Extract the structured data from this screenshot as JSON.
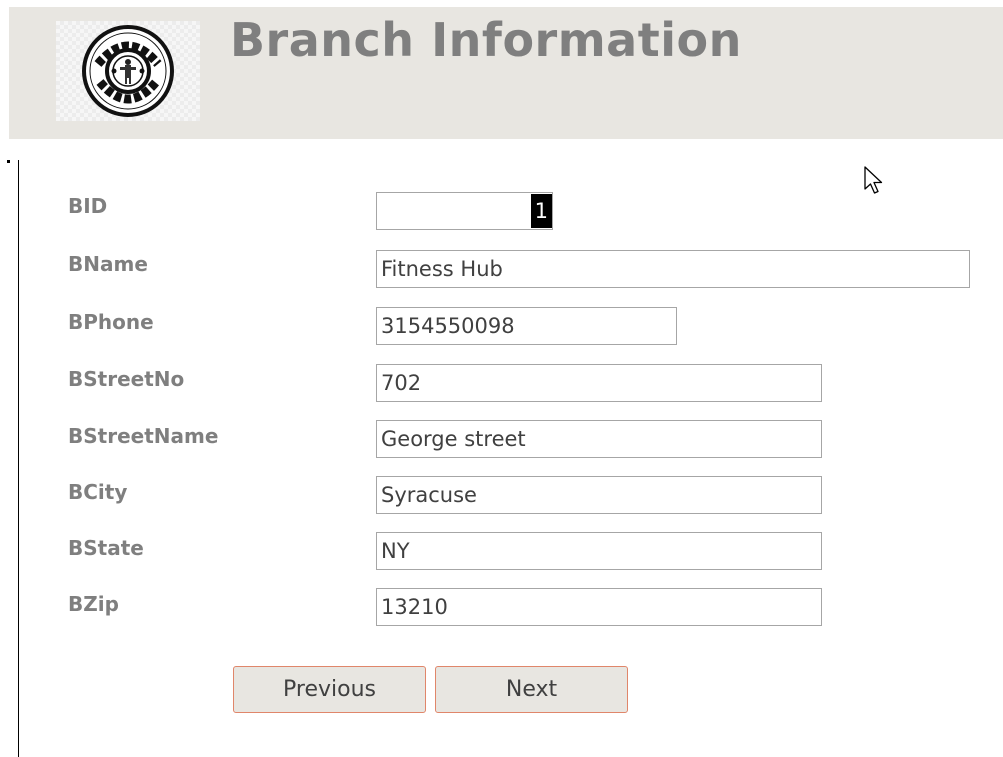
{
  "header": {
    "title": "Branch Information",
    "logo_icon": "golds-gym-logo-icon"
  },
  "form": {
    "fields": [
      {
        "label": "BID",
        "value": "1"
      },
      {
        "label": "BName",
        "value": "Fitness Hub"
      },
      {
        "label": "BPhone",
        "value": "3154550098"
      },
      {
        "label": "BStreetNo",
        "value": "702"
      },
      {
        "label": "BStreetName",
        "value": "George street"
      },
      {
        "label": "BCity",
        "value": "Syracuse"
      },
      {
        "label": "BState",
        "value": "NY"
      },
      {
        "label": "BZip",
        "value": "13210"
      }
    ]
  },
  "buttons": {
    "previous": "Previous",
    "next": "Next"
  },
  "colors": {
    "header_bg": "#e8e6e1",
    "label_text": "#7f7f7f",
    "button_border": "#e0866a"
  }
}
